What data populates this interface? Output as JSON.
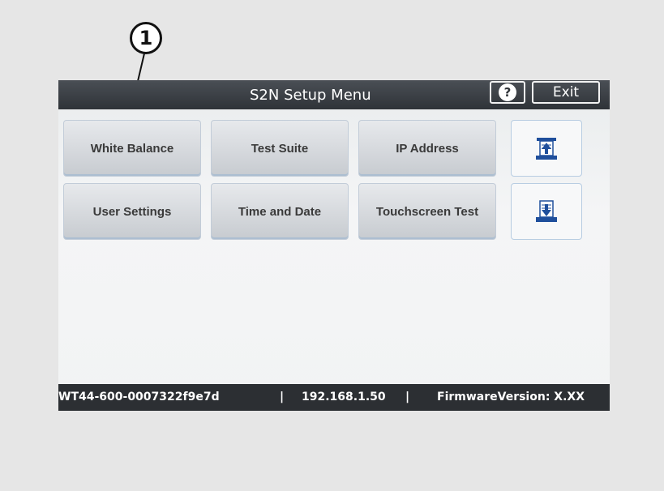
{
  "callout": {
    "number": "1"
  },
  "header": {
    "title": "S2N Setup Menu",
    "help_label": "?",
    "exit_label": "Exit"
  },
  "menu": {
    "buttons": [
      {
        "label": "White Balance"
      },
      {
        "label": "Test Suite"
      },
      {
        "label": "IP Address"
      },
      {
        "label": "User Settings"
      },
      {
        "label": "Time and Date"
      },
      {
        "label": "Touchscreen Test"
      }
    ],
    "icon_buttons": [
      {
        "icon": "upload-tray-icon"
      },
      {
        "icon": "download-tray-icon"
      }
    ]
  },
  "status": {
    "device_id": "WT44-600-0007322f9e7d",
    "sep": "|",
    "ip": "192.168.1.50",
    "firmware": "FirmwareVersion: X.XX"
  },
  "colors": {
    "titlebar": "#2f3338",
    "statusbar": "#2c2f33",
    "icon_blue": "#1f4f9c"
  }
}
